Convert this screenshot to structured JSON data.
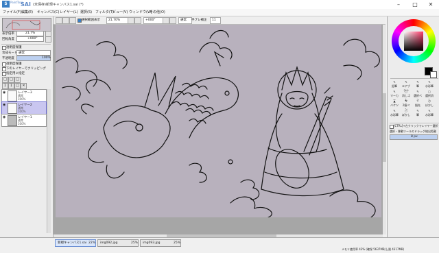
{
  "app": {
    "name": "SAI",
    "logo_text": "PaintTool",
    "window_title": "(未保存)新規キャンバス1.sai (*)"
  },
  "menu": [
    "ファイル(F)",
    "編集(E)",
    "キャンバス(C)",
    "レイヤー(L)",
    "選択(S)",
    "フィルタ(T)",
    "ビュー(V)",
    "ウィンドウ(W)",
    "その他(O)"
  ],
  "left": {
    "zoom_label": "表示倍率",
    "zoom_value": "21.7%",
    "rotate_label": "回転角度",
    "rotate_value": "+000°",
    "mode_label": "合成モード",
    "mode_value": "通常",
    "opacity_label": "不透明度",
    "opacity_value": "100%",
    "protect_label": "透明度保護",
    "checks": [
      "透明度保護",
      "下のレイヤーでクリッピング",
      "指定用に指定"
    ],
    "layers": [
      {
        "name": "レイヤー3",
        "mode": "通常",
        "opacity": "100%"
      },
      {
        "name": "レイヤー2",
        "mode": "通常",
        "opacity": "100%"
      },
      {
        "name": "レイヤー1",
        "mode": "通常",
        "opacity": "100%"
      }
    ]
  },
  "toolbar": {
    "selection_check": "選択範囲表示",
    "zoom": "21.70%",
    "angle": "+000°",
    "mode": "通常",
    "stabilizer_label": "手ブレ補正",
    "stabilizer_value": "11"
  },
  "right": {
    "tools": [
      "鉛筆",
      "エアブラシ",
      "筆",
      "水彩筆",
      "マーカー",
      "消しゴム",
      "選択ペン",
      "選択消し",
      "バケツ",
      "2値ペン",
      "指先",
      "ぼかし",
      "水彩筆",
      "ぼかし",
      "筆",
      "水彩筆"
    ],
    "option_check": "[CTRL]+左クリックでレイヤー選択",
    "radius_label": "選択・移動ツールのドラッグ検出距離",
    "radius_value": "8 px"
  },
  "tabs": [
    {
      "name": "新規キャンバス1.sai",
      "zoom": "22%"
    },
    {
      "name": "img092.jpg",
      "zoom": "25%"
    },
    {
      "name": "img093.jpg",
      "zoom": "25%"
    }
  ],
  "status": {
    "memory": "メモリ使用率 43% (確保 5637MB/上限 4317MB)"
  },
  "colors": {
    "canvas": "#b8b1bd",
    "accent": "#5b87c6",
    "selected_layer": "#c9c6f0"
  }
}
